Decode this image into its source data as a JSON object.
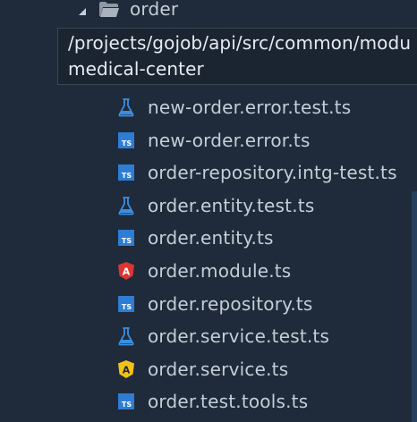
{
  "folder": {
    "name": "order",
    "expanded": true,
    "icon": "folder-open-icon"
  },
  "tooltip": {
    "line1": "/projects/gojob/api/src/common/modu",
    "line2": "medical-center"
  },
  "files": [
    {
      "name": "new-order.error.test.ts",
      "icon": "test-flask-icon"
    },
    {
      "name": "new-order.error.ts",
      "icon": "typescript-icon"
    },
    {
      "name": "order-repository.intg-test.ts",
      "icon": "typescript-icon"
    },
    {
      "name": "order.entity.test.ts",
      "icon": "test-flask-icon"
    },
    {
      "name": "order.entity.ts",
      "icon": "typescript-icon"
    },
    {
      "name": "order.module.ts",
      "icon": "angular-module-icon"
    },
    {
      "name": "order.repository.ts",
      "icon": "typescript-icon"
    },
    {
      "name": "order.service.test.ts",
      "icon": "test-flask-icon"
    },
    {
      "name": "order.service.ts",
      "icon": "angular-service-icon"
    },
    {
      "name": "order.test.tools.ts",
      "icon": "typescript-icon"
    }
  ],
  "icon_glyphs": {
    "typescript": "TS",
    "angular": "A"
  },
  "colors": {
    "background": "#1f2b3a",
    "text": "#c5cdd6",
    "typescript": "#2f7dd3",
    "angular_module": "#dd3534",
    "angular_service": "#f2c21b",
    "test_flask": "#3b8fe0"
  }
}
